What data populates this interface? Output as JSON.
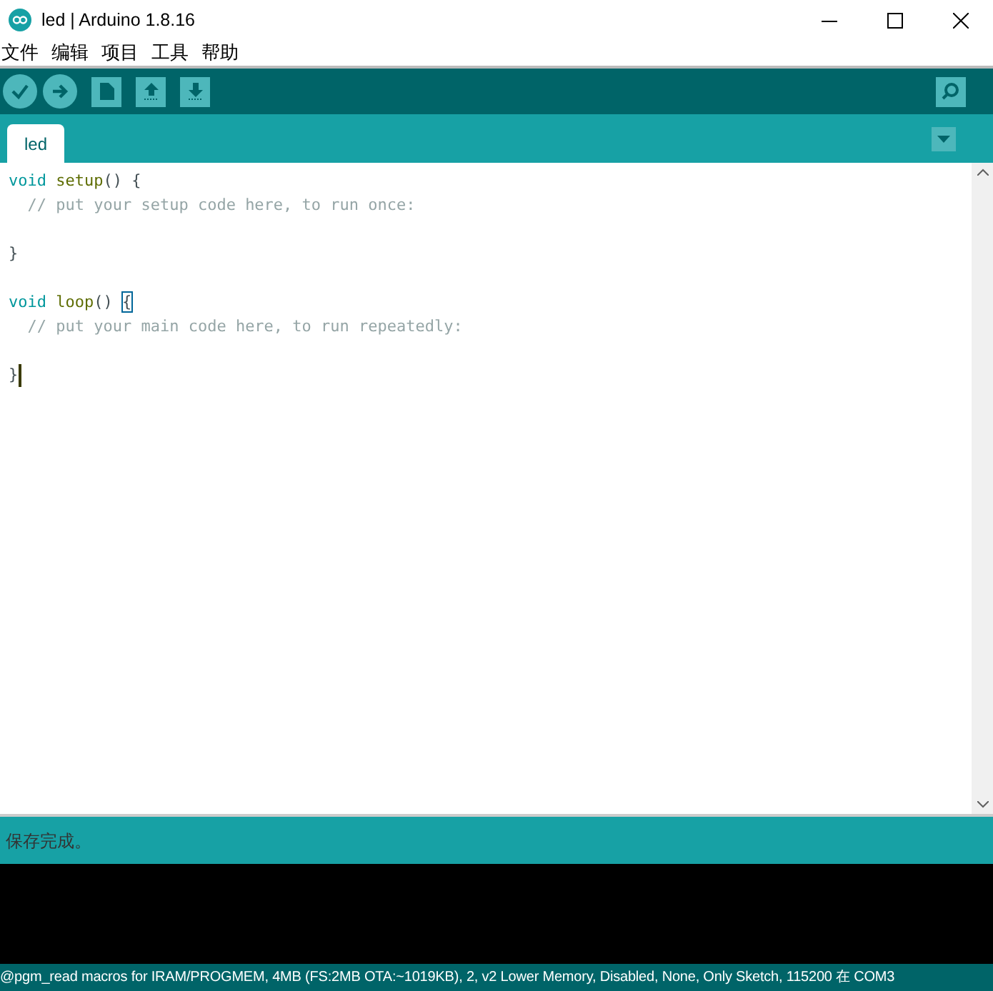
{
  "window": {
    "title": "led | Arduino 1.8.16"
  },
  "menu": [
    "文件",
    "编辑",
    "项目",
    "工具",
    "帮助"
  ],
  "tabs": [
    {
      "label": "led",
      "selected": true
    }
  ],
  "editor": {
    "lines": [
      {
        "kind": "code",
        "tokens": [
          {
            "kind": "keyword",
            "text": "void "
          },
          {
            "kind": "function",
            "text": "setup"
          },
          {
            "kind": "plain",
            "text": "() {"
          }
        ]
      },
      {
        "kind": "code",
        "tokens": [
          {
            "kind": "comment",
            "text": "  // put your setup code here, to run once:"
          }
        ]
      },
      {
        "kind": "blank"
      },
      {
        "kind": "code",
        "tokens": [
          {
            "kind": "plain",
            "text": "}"
          }
        ]
      },
      {
        "kind": "blank"
      },
      {
        "kind": "code",
        "tokens": [
          {
            "kind": "keyword",
            "text": "void "
          },
          {
            "kind": "function",
            "text": "loop"
          },
          {
            "kind": "plain",
            "text": "() "
          },
          {
            "kind": "bracket",
            "text": "{"
          }
        ]
      },
      {
        "kind": "code",
        "tokens": [
          {
            "kind": "comment",
            "text": "  // put your main code here, to run repeatedly:"
          }
        ]
      },
      {
        "kind": "blank"
      },
      {
        "kind": "code",
        "caret": true,
        "tokens": [
          {
            "kind": "plain",
            "text": "}"
          }
        ]
      }
    ]
  },
  "message": "保存完成。",
  "status_bar": "@pgm_read macros for IRAM/PROGMEM, 4MB (FS:2MB OTA:~1019KB), 2, v2 Lower Memory, Disabled, None, Only Sketch, 115200 在 COM3"
}
